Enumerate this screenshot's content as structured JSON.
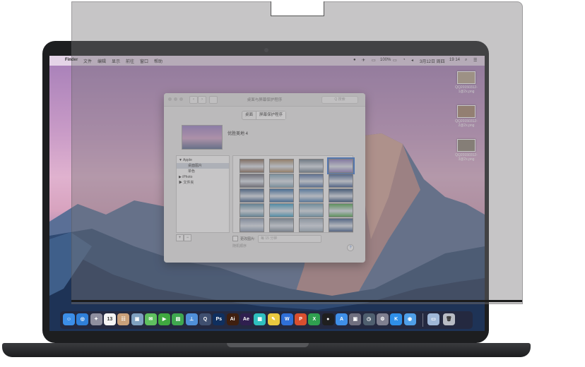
{
  "menubar": {
    "apple": "",
    "app": "Finder",
    "items": [
      "文件",
      "编辑",
      "显示",
      "前往",
      "窗口",
      "帮助"
    ],
    "status": {
      "battery": "100%",
      "date": "3月12日 周四",
      "time": "19 14"
    }
  },
  "desktop_files": [
    {
      "label": "QQ20150312-1@2x.png"
    },
    {
      "label": "QQ20150312-2@2x.png"
    },
    {
      "label": "QQ20150312-3@2x.png"
    }
  ],
  "window": {
    "title": "桌面与屏幕保护程序",
    "search_placeholder": "Q 搜索",
    "tabs": [
      "桌面",
      "屏幕保护程序"
    ],
    "active_tab": "屏幕保护程序",
    "preview_name": "优胜美地 4",
    "sources": [
      {
        "label": "▼ Apple",
        "selected": false
      },
      {
        "label": "桌面图片",
        "selected": true
      },
      {
        "label": "单色",
        "selected": false
      },
      {
        "label": "▶ iPhoto",
        "selected": false
      },
      {
        "label": "▶ 文件夹",
        "selected": false
      }
    ],
    "add_label": "+",
    "remove_label": "−",
    "change_picture_label": "更改图片:",
    "interval_value": "每 15 分钟",
    "random_label": "随机顺序",
    "help_label": "?"
  },
  "thumbnail_colors": [
    [
      "#8a6d5a",
      "#a98963",
      "#6f7f8f",
      "#8f7fc0"
    ],
    [
      "#6d6f7c",
      "#7fa4b8",
      "#4c6fa4",
      "#3f5f94"
    ],
    [
      "#3c5f8a",
      "#2f6ba8",
      "#4a7fb8",
      "#2c4f7c"
    ],
    [
      "#5c8fa8",
      "#3c9fc8",
      "#6fa0b8",
      "#4fa84f"
    ],
    [
      "#8f9fb8",
      "#7f8f9f",
      "#9fb0c0",
      "#3f5f8f"
    ]
  ],
  "dock_icons": [
    {
      "name": "finder-icon",
      "glyph": "☺",
      "color": "#3c8ee8"
    },
    {
      "name": "safari-icon",
      "glyph": "◎",
      "color": "#2f7fd8"
    },
    {
      "name": "launchpad-icon",
      "glyph": "✦",
      "color": "#8f8f9f"
    },
    {
      "name": "calendar-icon",
      "glyph": "13",
      "color": "#f4f4f4"
    },
    {
      "name": "contacts-icon",
      "glyph": "☷",
      "color": "#c9a07a"
    },
    {
      "name": "preview-icon",
      "glyph": "▣",
      "color": "#7fa0c0"
    },
    {
      "name": "messages-icon",
      "glyph": "✉",
      "color": "#5fbf5f"
    },
    {
      "name": "facetime-icon",
      "glyph": "▶",
      "color": "#3fa83f"
    },
    {
      "name": "numbers-icon",
      "glyph": "▤",
      "color": "#3fa84f"
    },
    {
      "name": "keynote-icon",
      "glyph": "⊥",
      "color": "#4f8fd8"
    },
    {
      "name": "quicktime-icon",
      "glyph": "Q",
      "color": "#3f4f6f"
    },
    {
      "name": "photoshop-icon",
      "glyph": "Ps",
      "color": "#0f2f5f"
    },
    {
      "name": "illustrator-icon",
      "glyph": "Ai",
      "color": "#3f1f0f"
    },
    {
      "name": "aftereffects-icon",
      "glyph": "Ae",
      "color": "#2f1f4f"
    },
    {
      "name": "app-teal-icon",
      "glyph": "▦",
      "color": "#2fbfbf"
    },
    {
      "name": "sticky-notes-icon",
      "glyph": "✎",
      "color": "#e8c83f"
    },
    {
      "name": "word-icon",
      "glyph": "W",
      "color": "#2f6fd8"
    },
    {
      "name": "powerpoint-icon",
      "glyph": "P",
      "color": "#d84f2f"
    },
    {
      "name": "excel-icon",
      "glyph": "X",
      "color": "#2f9f4f"
    },
    {
      "name": "qq-icon",
      "glyph": "●",
      "color": "#1f1f1f"
    },
    {
      "name": "appstore-icon",
      "glyph": "A",
      "color": "#3f8fe8"
    },
    {
      "name": "screenshot-icon",
      "glyph": "▣",
      "color": "#6f6f7f"
    },
    {
      "name": "timemachine-icon",
      "glyph": "◷",
      "color": "#4f5f6f"
    },
    {
      "name": "system-prefs-icon",
      "glyph": "⚙",
      "color": "#7f7f8f"
    },
    {
      "name": "kugou-icon",
      "glyph": "K",
      "color": "#2f8fe8"
    },
    {
      "name": "qq-browser-icon",
      "glyph": "◉",
      "color": "#4f9fe8"
    },
    {
      "name": "downloads-folder-icon",
      "glyph": "▭",
      "color": "#9fb8d8"
    },
    {
      "name": "trash-icon",
      "glyph": "🗑",
      "color": "#b8bcc4"
    }
  ]
}
